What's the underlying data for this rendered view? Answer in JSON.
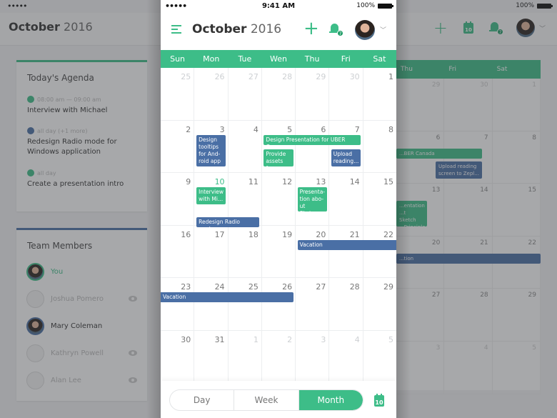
{
  "colors": {
    "accent": "#3dbd88",
    "blue": "#4a6fa5"
  },
  "status": {
    "signal": "•••••",
    "time": "9:41 AM",
    "battery": "100%"
  },
  "header": {
    "month": "October",
    "year": "2016",
    "notifications": "7",
    "today_day": "10"
  },
  "weekdays": [
    "Sun",
    "Mon",
    "Tue",
    "Wen",
    "Thu",
    "Fri",
    "Sat"
  ],
  "weeks": [
    [
      {
        "d": "25",
        "out": true
      },
      {
        "d": "26",
        "out": true
      },
      {
        "d": "27",
        "out": true
      },
      {
        "d": "28",
        "out": true
      },
      {
        "d": "29",
        "out": true
      },
      {
        "d": "30",
        "out": true
      },
      {
        "d": "1"
      }
    ],
    [
      {
        "d": "2"
      },
      {
        "d": "3"
      },
      {
        "d": "4"
      },
      {
        "d": "5"
      },
      {
        "d": "6"
      },
      {
        "d": "7"
      },
      {
        "d": "8"
      }
    ],
    [
      {
        "d": "9"
      },
      {
        "d": "10",
        "today": true
      },
      {
        "d": "11"
      },
      {
        "d": "12"
      },
      {
        "d": "13"
      },
      {
        "d": "14"
      },
      {
        "d": "15"
      }
    ],
    [
      {
        "d": "16"
      },
      {
        "d": "17"
      },
      {
        "d": "18"
      },
      {
        "d": "19"
      },
      {
        "d": "20"
      },
      {
        "d": "21"
      },
      {
        "d": "22"
      }
    ],
    [
      {
        "d": "23"
      },
      {
        "d": "24"
      },
      {
        "d": "25"
      },
      {
        "d": "26"
      },
      {
        "d": "27"
      },
      {
        "d": "28"
      },
      {
        "d": "29"
      }
    ],
    [
      {
        "d": "30"
      },
      {
        "d": "31"
      },
      {
        "d": "1",
        "out": true
      },
      {
        "d": "2",
        "out": true
      },
      {
        "d": "3",
        "out": true
      },
      {
        "d": "4",
        "out": true
      },
      {
        "d": "5",
        "out": true
      }
    ]
  ],
  "events": [
    {
      "week": 1,
      "start": 1,
      "span": 1,
      "lane": 0,
      "color": "blue",
      "title": "Design\ntooltips\nfor And-\nroid app",
      "tall": 4
    },
    {
      "week": 1,
      "start": 3,
      "span": 3,
      "lane": 0,
      "color": "green",
      "title": "Design Presentation for UBER Can...",
      "tall": 1
    },
    {
      "week": 1,
      "start": 3,
      "span": 1,
      "lane": 1,
      "color": "green",
      "title": "Provide\nassets f...",
      "tall": 2
    },
    {
      "week": 1,
      "start": 5,
      "span": 1,
      "lane": 1,
      "color": "blue",
      "title": "Upload\nreading...",
      "tall": 2
    },
    {
      "week": 2,
      "start": 1,
      "span": 1,
      "lane": 0,
      "color": "green",
      "title": "Interview\nwith Mi...",
      "tall": 2
    },
    {
      "week": 2,
      "start": 1,
      "span": 2,
      "lane": 2,
      "color": "blue",
      "title": "Redesign Radio mode...",
      "tall": 1
    },
    {
      "week": 2,
      "start": 4,
      "span": 1,
      "lane": 0,
      "color": "green",
      "title": "Presenta-\ntion abo-\nut Sketc...",
      "tall": 3
    },
    {
      "week": 3,
      "start": 4,
      "span": 3,
      "lane": 0,
      "color": "blue",
      "title": "Vacation",
      "tall": 1,
      "open_right": true
    },
    {
      "week": 4,
      "start": 0,
      "span": 4,
      "lane": 0,
      "color": "blue",
      "title": "Vacation",
      "tall": 1,
      "open_left": true
    }
  ],
  "views": {
    "day": "Day",
    "week": "Week",
    "month": "Month",
    "active": "Month"
  },
  "agenda": {
    "title": "Today's Agenda",
    "items": [
      {
        "time": "08:00 am — 09:00 am",
        "title": "Interview with Michael",
        "color": "green"
      },
      {
        "time": "all day (+1 more)",
        "title": "Redesign Radio mode for Windows application",
        "color": "blue"
      },
      {
        "time": "all day",
        "title": "Create a presentation intro",
        "color": "green"
      }
    ]
  },
  "team": {
    "title": "Team Members",
    "members": [
      {
        "name": "You",
        "active": true,
        "self": true
      },
      {
        "name": "Joshua Pomero",
        "active": false
      },
      {
        "name": "Mary Coleman",
        "active": true
      },
      {
        "name": "Kathryn Powell",
        "active": false
      },
      {
        "name": "Alan Lee",
        "active": false
      }
    ]
  },
  "bg_calendar": {
    "weekdays": [
      "Thu",
      "Fri",
      "Sat"
    ],
    "rows": [
      [
        "29",
        "30",
        "1"
      ],
      [
        "6",
        "7",
        "8"
      ],
      [
        "13",
        "14",
        "15"
      ],
      [
        "20",
        "21",
        "22"
      ],
      [
        "27",
        "28",
        "29"
      ],
      [
        "3",
        "4",
        "5"
      ]
    ],
    "events": [
      {
        "title": "...BER Canada"
      },
      {
        "title": "Upload reading screen to Zepl..."
      },
      {
        "title": "...entation\n...t Sketch\n...Principle"
      },
      {
        "title": "...tion"
      }
    ]
  }
}
